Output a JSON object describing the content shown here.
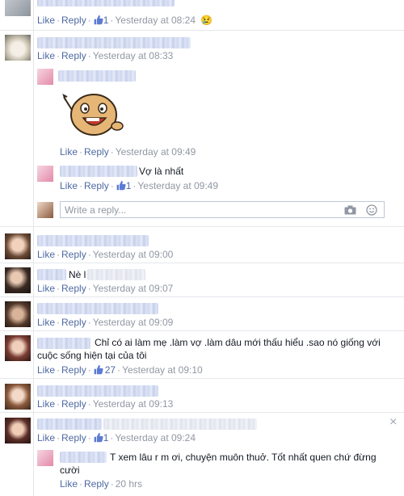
{
  "labels": {
    "like": "Like",
    "reply": "Reply",
    "sep": "·"
  },
  "comments": [
    {
      "id": "c1",
      "like_count": "1",
      "time": "Yesterday at 08:24",
      "emoji": "😢"
    },
    {
      "id": "c2",
      "time": "Yesterday at 08:33"
    },
    {
      "id": "r1",
      "time": "Yesterday at 09:49"
    },
    {
      "id": "r2",
      "text": "Vợ là nhất",
      "like_count": "1",
      "time": "Yesterday at 09:49"
    },
    {
      "id": "c3",
      "time": "Yesterday at 09:00"
    },
    {
      "id": "c4",
      "text": "Nè l",
      "time": "Yesterday at 09:07"
    },
    {
      "id": "c5",
      "time": "Yesterday at 09:09"
    },
    {
      "id": "c6",
      "text_line1": "Chỉ có ai làm mẹ .làm vợ .làm dâu mới thấu hiểu .sao nó giống với",
      "text_line2": "cuộc sống hiện tại của tôi",
      "like_count": "27",
      "time": "Yesterday at 09:10"
    },
    {
      "id": "c7",
      "time": "Yesterday at 09:13"
    },
    {
      "id": "c8",
      "like_count": "1",
      "time": "Yesterday at 09:24"
    },
    {
      "id": "r3",
      "text_line1": "T xem lâu r m ơi, chuyện muôn thuở. Tốt nhất quen chứ đừng",
      "text_line2": "cười",
      "time": "20 hrs"
    }
  ],
  "reply_box": {
    "placeholder": "Write a reply..."
  },
  "icons": {
    "camera": "camera-icon",
    "emoji": "smiley-icon",
    "close": "close-icon",
    "like": "thumbs-up-icon"
  },
  "colors": {
    "link": "#4e69a2",
    "meta": "#9197a3",
    "text": "#141823"
  }
}
